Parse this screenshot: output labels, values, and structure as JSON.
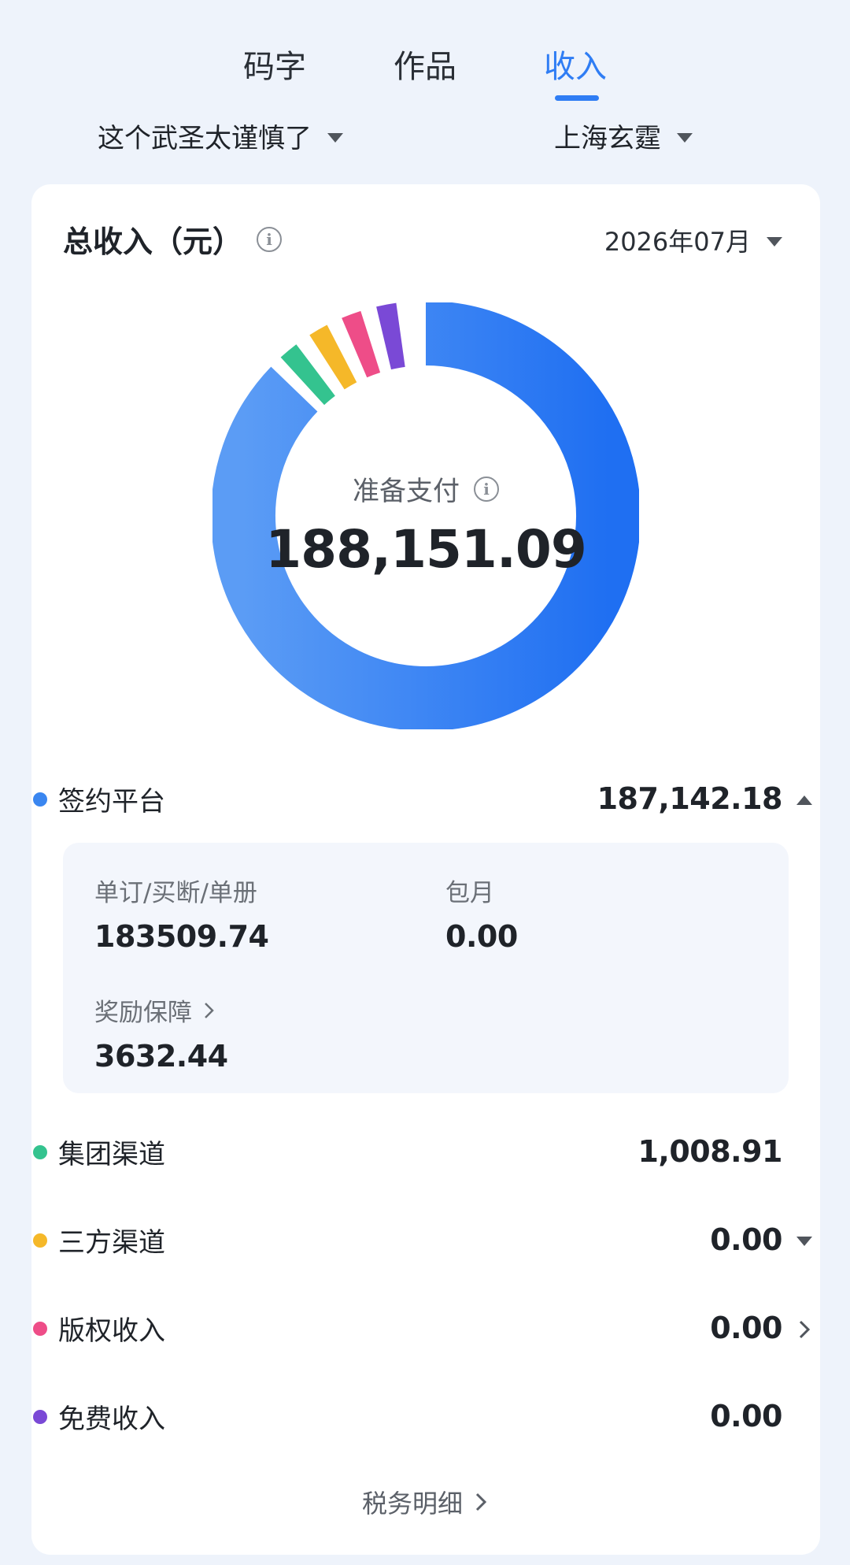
{
  "tabs": [
    {
      "label": "码字"
    },
    {
      "label": "作品"
    },
    {
      "label": "收入",
      "active": true
    }
  ],
  "selectors": {
    "book": "这个武圣太谨慎了",
    "publisher": "上海玄霆"
  },
  "card": {
    "title": "总收入（元）",
    "month": "2026年07月"
  },
  "donut": {
    "center_label": "准备支付",
    "center_value": "188,151.09"
  },
  "chart_data": {
    "type": "pie",
    "segments": [
      {
        "name": "签约平台",
        "value": 187142.18,
        "color": "#3a86f0"
      },
      {
        "name": "集团渠道",
        "value": 1008.91,
        "color": "#34c38f"
      },
      {
        "name": "三方渠道",
        "value": 0.0,
        "color": "#f5b829"
      },
      {
        "name": "版权收入",
        "value": 0.0,
        "color": "#ee4d88"
      },
      {
        "name": "免费收入",
        "value": 0.0,
        "color": "#7a49d6"
      }
    ]
  },
  "rows": [
    {
      "label": "签约平台",
      "value": "187,142.18",
      "color": "#3a86f0",
      "icon": "triangle-up-icon"
    },
    {
      "label": "集团渠道",
      "value": "1,008.91",
      "color": "#34c38f",
      "icon": ""
    },
    {
      "label": "三方渠道",
      "value": "0.00",
      "color": "#f5b829",
      "icon": "triangle-down-icon"
    },
    {
      "label": "版权收入",
      "value": "0.00",
      "color": "#ee4d88",
      "icon": "chevron-right-icon"
    },
    {
      "label": "免费收入",
      "value": "0.00",
      "color": "#7a49d6",
      "icon": ""
    }
  ],
  "subpanel": {
    "single": {
      "label": "单订/买断/单册",
      "value": "183509.74"
    },
    "monthly": {
      "label": "包月",
      "value": "0.00"
    },
    "reward": {
      "label": "奖励保障",
      "value": "3632.44"
    }
  },
  "footer": {
    "tax_link": "税务明细"
  }
}
